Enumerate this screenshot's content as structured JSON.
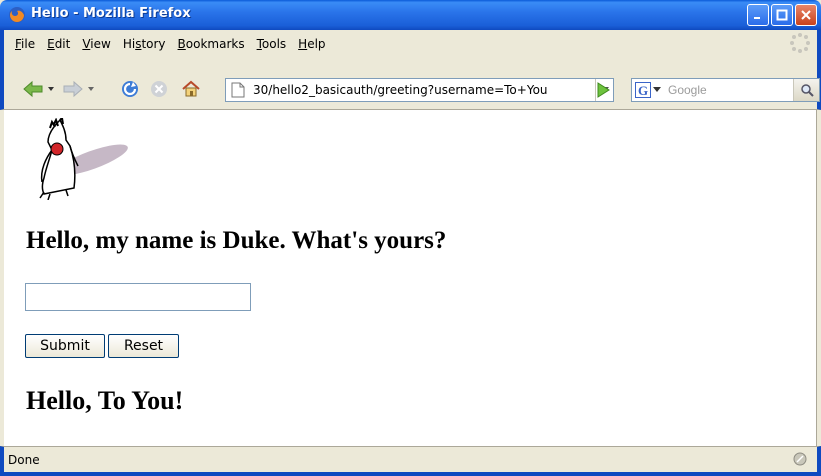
{
  "window": {
    "title": "Hello - Mozilla Firefox",
    "accent": "#0a5ad8"
  },
  "menubar": {
    "items": [
      {
        "underline": "F",
        "rest": "ile"
      },
      {
        "underline": "E",
        "rest": "dit"
      },
      {
        "underline": "V",
        "rest": "iew"
      },
      {
        "prefix": "Hi",
        "underline": "s",
        "rest": "tory"
      },
      {
        "underline": "B",
        "rest": "ookmarks"
      },
      {
        "underline": "T",
        "rest": "ools"
      },
      {
        "underline": "H",
        "rest": "elp"
      }
    ]
  },
  "navbar": {
    "url": "30/hello2_basicauth/greeting?username=To+You",
    "search_placeholder": "Google",
    "icons": [
      "back-icon",
      "forward-icon",
      "reload-icon",
      "stop-icon",
      "home-icon",
      "page-icon",
      "go-icon",
      "google-icon",
      "search-icon"
    ]
  },
  "content": {
    "greeting": "Hello, my name is Duke. What's yours?",
    "name_input_value": "",
    "submit_label": "Submit",
    "reset_label": "Reset",
    "response": "Hello, To You!"
  },
  "statusbar": {
    "text": "Done"
  }
}
